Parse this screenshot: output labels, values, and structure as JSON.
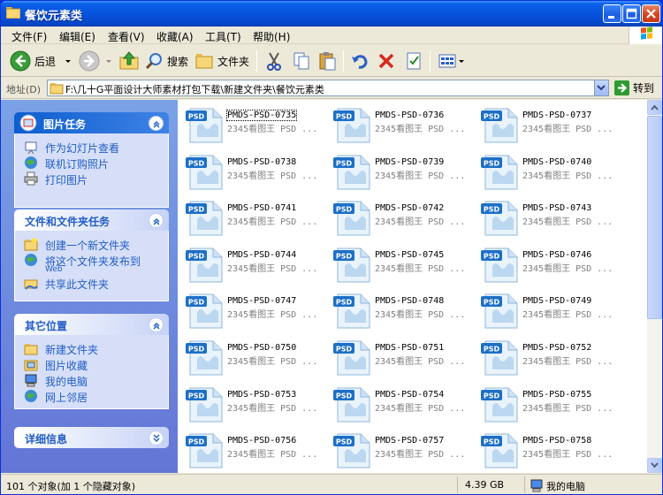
{
  "window": {
    "title": "餐饮元素类"
  },
  "menu": [
    "文件(F)",
    "编辑(E)",
    "查看(V)",
    "收藏(A)",
    "工具(T)",
    "帮助(H)"
  ],
  "toolbar": {
    "back": "后退",
    "search": "搜索",
    "folders": "文件夹"
  },
  "address": {
    "label": "地址(D)",
    "path": "F:\\几十G平面设计大师素材打包下载\\新建文件夹\\餐饮元素类",
    "go": "转到"
  },
  "left_pane": {
    "picture_tasks": {
      "title": "图片任务",
      "items": [
        "作为幻灯片查看",
        "联机订购照片",
        "打印图片"
      ]
    },
    "file_tasks": {
      "title": "文件和文件夹任务",
      "items": [
        "创建一个新文件夹",
        "将这个文件夹发布到",
        "Web",
        "共享此文件夹"
      ]
    },
    "other_places": {
      "title": "其它位置",
      "items": [
        "新建文件夹",
        "图片收藏",
        "我的电脑",
        "网上邻居"
      ]
    },
    "details": {
      "title": "详细信息"
    }
  },
  "files": [
    {
      "name": "PMDS-PSD-0735",
      "desc": "2345看图王 PSD ..."
    },
    {
      "name": "PMDS-PSD-0736",
      "desc": "2345看图王 PSD ..."
    },
    {
      "name": "PMDS-PSD-0737",
      "desc": "2345看图王 PSD ..."
    },
    {
      "name": "PMDS-PSD-0738",
      "desc": "2345看图王 PSD ..."
    },
    {
      "name": "PMDS-PSD-0739",
      "desc": "2345看图王 PSD ..."
    },
    {
      "name": "PMDS-PSD-0740",
      "desc": "2345看图王 PSD ..."
    },
    {
      "name": "PMDS-PSD-0741",
      "desc": "2345看图王 PSD ..."
    },
    {
      "name": "PMDS-PSD-0742",
      "desc": "2345看图王 PSD ..."
    },
    {
      "name": "PMDS-PSD-0743",
      "desc": "2345看图王 PSD ..."
    },
    {
      "name": "PMDS-PSD-0744",
      "desc": "2345看图王 PSD ..."
    },
    {
      "name": "PMDS-PSD-0745",
      "desc": "2345看图王 PSD ..."
    },
    {
      "name": "PMDS-PSD-0746",
      "desc": "2345看图王 PSD ..."
    },
    {
      "name": "PMDS-PSD-0747",
      "desc": "2345看图王 PSD ..."
    },
    {
      "name": "PMDS-PSD-0748",
      "desc": "2345看图王 PSD ..."
    },
    {
      "name": "PMDS-PSD-0749",
      "desc": "2345看图王 PSD ..."
    },
    {
      "name": "PMDS-PSD-0750",
      "desc": "2345看图王 PSD ..."
    },
    {
      "name": "PMDS-PSD-0751",
      "desc": "2345看图王 PSD ..."
    },
    {
      "name": "PMDS-PSD-0752",
      "desc": "2345看图王 PSD ..."
    },
    {
      "name": "PMDS-PSD-0753",
      "desc": "2345看图王 PSD ..."
    },
    {
      "name": "PMDS-PSD-0754",
      "desc": "2345看图王 PSD ..."
    },
    {
      "name": "PMDS-PSD-0755",
      "desc": "2345看图王 PSD ..."
    },
    {
      "name": "PMDS-PSD-0756",
      "desc": "2345看图王 PSD ..."
    },
    {
      "name": "PMDS-PSD-0757",
      "desc": "2345看图王 PSD ..."
    },
    {
      "name": "PMDS-PSD-0758",
      "desc": "2345看图王 PSD ..."
    }
  ],
  "file_badge": "PSD",
  "status": {
    "objects": "101 个对象(加 1 个隐藏对象)",
    "size": "4.39 GB",
    "location": "我的电脑"
  }
}
